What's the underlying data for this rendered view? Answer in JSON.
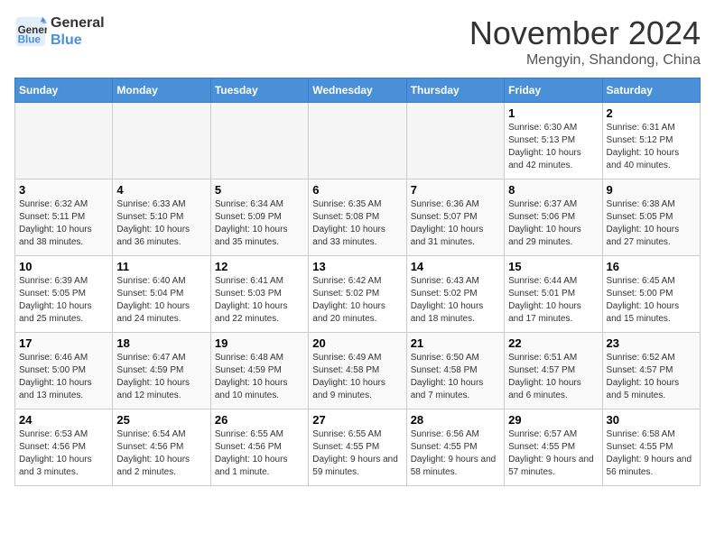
{
  "logo": {
    "text_general": "General",
    "text_blue": "Blue"
  },
  "title": "November 2024",
  "location": "Mengyin, Shandong, China",
  "weekdays": [
    "Sunday",
    "Monday",
    "Tuesday",
    "Wednesday",
    "Thursday",
    "Friday",
    "Saturday"
  ],
  "weeks": [
    [
      {
        "day": "",
        "info": ""
      },
      {
        "day": "",
        "info": ""
      },
      {
        "day": "",
        "info": ""
      },
      {
        "day": "",
        "info": ""
      },
      {
        "day": "",
        "info": ""
      },
      {
        "day": "1",
        "info": "Sunrise: 6:30 AM\nSunset: 5:13 PM\nDaylight: 10 hours and 42 minutes."
      },
      {
        "day": "2",
        "info": "Sunrise: 6:31 AM\nSunset: 5:12 PM\nDaylight: 10 hours and 40 minutes."
      }
    ],
    [
      {
        "day": "3",
        "info": "Sunrise: 6:32 AM\nSunset: 5:11 PM\nDaylight: 10 hours and 38 minutes."
      },
      {
        "day": "4",
        "info": "Sunrise: 6:33 AM\nSunset: 5:10 PM\nDaylight: 10 hours and 36 minutes."
      },
      {
        "day": "5",
        "info": "Sunrise: 6:34 AM\nSunset: 5:09 PM\nDaylight: 10 hours and 35 minutes."
      },
      {
        "day": "6",
        "info": "Sunrise: 6:35 AM\nSunset: 5:08 PM\nDaylight: 10 hours and 33 minutes."
      },
      {
        "day": "7",
        "info": "Sunrise: 6:36 AM\nSunset: 5:07 PM\nDaylight: 10 hours and 31 minutes."
      },
      {
        "day": "8",
        "info": "Sunrise: 6:37 AM\nSunset: 5:06 PM\nDaylight: 10 hours and 29 minutes."
      },
      {
        "day": "9",
        "info": "Sunrise: 6:38 AM\nSunset: 5:05 PM\nDaylight: 10 hours and 27 minutes."
      }
    ],
    [
      {
        "day": "10",
        "info": "Sunrise: 6:39 AM\nSunset: 5:05 PM\nDaylight: 10 hours and 25 minutes."
      },
      {
        "day": "11",
        "info": "Sunrise: 6:40 AM\nSunset: 5:04 PM\nDaylight: 10 hours and 24 minutes."
      },
      {
        "day": "12",
        "info": "Sunrise: 6:41 AM\nSunset: 5:03 PM\nDaylight: 10 hours and 22 minutes."
      },
      {
        "day": "13",
        "info": "Sunrise: 6:42 AM\nSunset: 5:02 PM\nDaylight: 10 hours and 20 minutes."
      },
      {
        "day": "14",
        "info": "Sunrise: 6:43 AM\nSunset: 5:02 PM\nDaylight: 10 hours and 18 minutes."
      },
      {
        "day": "15",
        "info": "Sunrise: 6:44 AM\nSunset: 5:01 PM\nDaylight: 10 hours and 17 minutes."
      },
      {
        "day": "16",
        "info": "Sunrise: 6:45 AM\nSunset: 5:00 PM\nDaylight: 10 hours and 15 minutes."
      }
    ],
    [
      {
        "day": "17",
        "info": "Sunrise: 6:46 AM\nSunset: 5:00 PM\nDaylight: 10 hours and 13 minutes."
      },
      {
        "day": "18",
        "info": "Sunrise: 6:47 AM\nSunset: 4:59 PM\nDaylight: 10 hours and 12 minutes."
      },
      {
        "day": "19",
        "info": "Sunrise: 6:48 AM\nSunset: 4:59 PM\nDaylight: 10 hours and 10 minutes."
      },
      {
        "day": "20",
        "info": "Sunrise: 6:49 AM\nSunset: 4:58 PM\nDaylight: 10 hours and 9 minutes."
      },
      {
        "day": "21",
        "info": "Sunrise: 6:50 AM\nSunset: 4:58 PM\nDaylight: 10 hours and 7 minutes."
      },
      {
        "day": "22",
        "info": "Sunrise: 6:51 AM\nSunset: 4:57 PM\nDaylight: 10 hours and 6 minutes."
      },
      {
        "day": "23",
        "info": "Sunrise: 6:52 AM\nSunset: 4:57 PM\nDaylight: 10 hours and 5 minutes."
      }
    ],
    [
      {
        "day": "24",
        "info": "Sunrise: 6:53 AM\nSunset: 4:56 PM\nDaylight: 10 hours and 3 minutes."
      },
      {
        "day": "25",
        "info": "Sunrise: 6:54 AM\nSunset: 4:56 PM\nDaylight: 10 hours and 2 minutes."
      },
      {
        "day": "26",
        "info": "Sunrise: 6:55 AM\nSunset: 4:56 PM\nDaylight: 10 hours and 1 minute."
      },
      {
        "day": "27",
        "info": "Sunrise: 6:55 AM\nSunset: 4:55 PM\nDaylight: 9 hours and 59 minutes."
      },
      {
        "day": "28",
        "info": "Sunrise: 6:56 AM\nSunset: 4:55 PM\nDaylight: 9 hours and 58 minutes."
      },
      {
        "day": "29",
        "info": "Sunrise: 6:57 AM\nSunset: 4:55 PM\nDaylight: 9 hours and 57 minutes."
      },
      {
        "day": "30",
        "info": "Sunrise: 6:58 AM\nSunset: 4:55 PM\nDaylight: 9 hours and 56 minutes."
      }
    ]
  ]
}
